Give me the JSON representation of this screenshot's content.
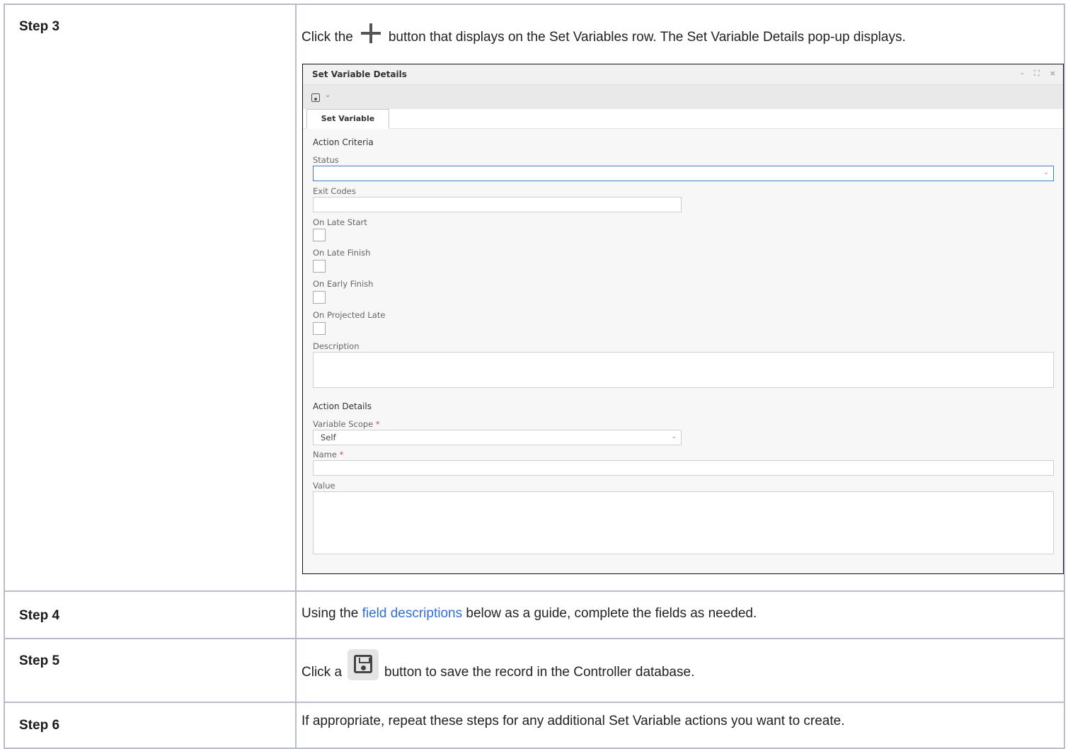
{
  "steps": [
    {
      "label": "Step 3",
      "text_before": "Click the",
      "text_after": "button that displays on the Set Variables row. The Set Variable Details pop-up displays."
    },
    {
      "label": "Step 4",
      "text_before": "Using the",
      "link": "field descriptions",
      "text_after": "below as a guide, complete the fields as needed."
    },
    {
      "label": "Step 5",
      "text_before": "Click a",
      "text_after": "button to save the record in the Controller database."
    },
    {
      "label": "Step 6",
      "text": "If appropriate, repeat these steps for any additional Set Variable actions you want to create."
    }
  ],
  "dialog": {
    "title": "Set Variable Details",
    "controls": {
      "minimize": "–",
      "maximize": "⛶",
      "close": "×"
    },
    "toolbar_chevron": "⌄",
    "tab": "Set Variable",
    "action_criteria": "Action Criteria",
    "status_label": "Status",
    "status_value": "",
    "exit_codes_label": "Exit Codes",
    "on_late_start": "On Late Start",
    "on_late_finish": "On Late Finish",
    "on_early_finish": "On Early Finish",
    "on_projected_late": "On Projected Late",
    "description_label": "Description",
    "action_details": "Action Details",
    "variable_scope_label": "Variable Scope",
    "variable_scope_value": "Self",
    "name_label": "Name",
    "value_label": "Value",
    "required_mark": "*",
    "dropdown_chevron": "⌄"
  }
}
